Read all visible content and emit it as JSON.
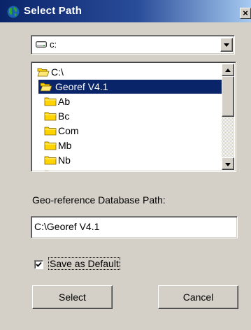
{
  "window": {
    "title": "Select Path",
    "close_label": "×"
  },
  "drive": {
    "selected": "c:",
    "icon": "drive-icon"
  },
  "directories": [
    {
      "label": "C:\\",
      "icon": "open-folder-icon",
      "selected": false
    },
    {
      "label": "Georef V4.1",
      "icon": "open-folder-icon",
      "selected": true
    },
    {
      "label": "Ab",
      "icon": "folder-icon",
      "selected": false
    },
    {
      "label": "Bc",
      "icon": "folder-icon",
      "selected": false
    },
    {
      "label": "Com",
      "icon": "folder-icon",
      "selected": false
    },
    {
      "label": "Mb",
      "icon": "folder-icon",
      "selected": false
    },
    {
      "label": "Nb",
      "icon": "folder-icon",
      "selected": false
    }
  ],
  "path_field": {
    "label": "Geo-reference Database Path:",
    "value": "C:\\Georef V4.1"
  },
  "save_default": {
    "label": "Save as Default",
    "checked": true
  },
  "buttons": {
    "select": "Select",
    "cancel": "Cancel"
  },
  "colors": {
    "title_bar": "#0a246a",
    "selection": "#0a246a",
    "face": "#d4d0c8",
    "folder": "#ffd400"
  }
}
